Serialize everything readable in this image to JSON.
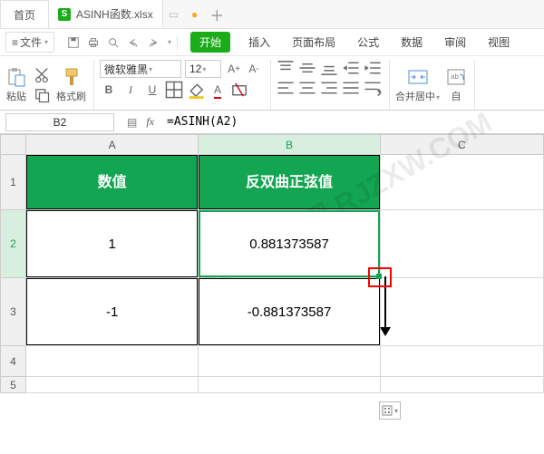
{
  "tabs": {
    "home": "首页",
    "file": "ASINH函数.xlsx"
  },
  "menu": {
    "file": "文件",
    "start": "开始",
    "insert": "插入",
    "layout": "页面布局",
    "formula": "公式",
    "data": "数据",
    "review": "审阅",
    "view": "视图"
  },
  "ribbon": {
    "paste": "粘贴",
    "format_painter": "格式刷",
    "font_name": "微软雅黑",
    "font_size": "12",
    "merge": "合并居中",
    "auto": "自"
  },
  "fx": {
    "cell_ref": "B2",
    "formula": "=ASINH(A2)"
  },
  "cols": {
    "A": "A",
    "B": "B",
    "C": "C"
  },
  "rows": {
    "r1": "1",
    "r2": "2",
    "r3": "3",
    "r4": "4",
    "r5": "5"
  },
  "sheet": {
    "header_a": "数值",
    "header_b": "反双曲正弦值",
    "a2": "1",
    "b2": "0.881373587",
    "a3": "-1",
    "b3": "-0.881373587"
  },
  "watermark": "软件自学网 RJZXW.COM",
  "chart_data": {
    "type": "table",
    "title": "ASINH函数",
    "columns": [
      "数值",
      "反双曲正弦值"
    ],
    "rows": [
      {
        "数值": 1,
        "反双曲正弦值": 0.881373587
      },
      {
        "数值": -1,
        "反双曲正弦值": -0.881373587
      }
    ],
    "formula": "=ASINH(A2)",
    "active_cell": "B2"
  }
}
